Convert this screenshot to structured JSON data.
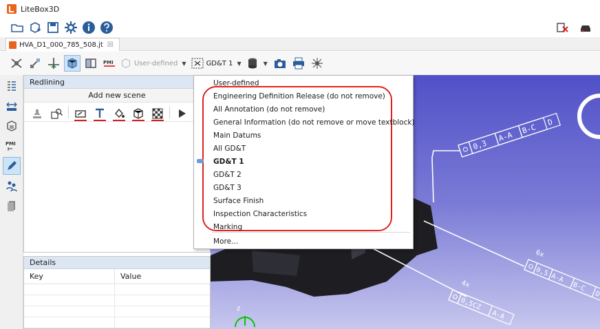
{
  "app": {
    "title": "LiteBox3D",
    "accent": "#e8641d"
  },
  "main_toolbar": {
    "icons": [
      "open-folder-icon",
      "add-model-icon",
      "save-icon",
      "settings-icon",
      "info-icon",
      "help-icon"
    ],
    "right_icons": [
      "close-model-icon",
      "car-icon"
    ]
  },
  "tab": {
    "label": "HVA_D1_000_785_508.jt",
    "close_glyph": "☒"
  },
  "view_toolbar": {
    "pmi_badge": "PMI",
    "view_combo": "User-defined",
    "pmi_combo": "GD&T 1"
  },
  "left_rail": {
    "pmi_label": "PMI"
  },
  "panel": {
    "title": "Redlining",
    "add_scene": "Add new scene"
  },
  "details": {
    "title": "Details",
    "columns": [
      "Key",
      "Value"
    ]
  },
  "dropdown": {
    "items": [
      "User-defined",
      "Engineering Definition Release (do not remove)",
      "All Annotation (do not remove)",
      "General Information (do not remove or move textblock)",
      "Main Datums",
      "All GD&T",
      "GD&T 1",
      "GD&T 2",
      "GD&T 3",
      "Surface Finish",
      "Inspection Characteristics",
      "Marking",
      "More..."
    ],
    "selected": "GD&T 1",
    "highlight_color": "#e02020"
  },
  "viewport": {
    "fcf_top": [
      "0,3",
      "A-A",
      "B-C",
      "D"
    ],
    "fcf_right_mult": "6x",
    "fcf_right": [
      "0,5",
      "A-A",
      "B-C",
      "D"
    ],
    "fcf_bottom_mult": "4x",
    "fcf_bottom": [
      "0,5CZ",
      "A-A"
    ],
    "axis_label": "z",
    "background_top": "#5151c8",
    "background_bottom": "#c7c7ee"
  }
}
